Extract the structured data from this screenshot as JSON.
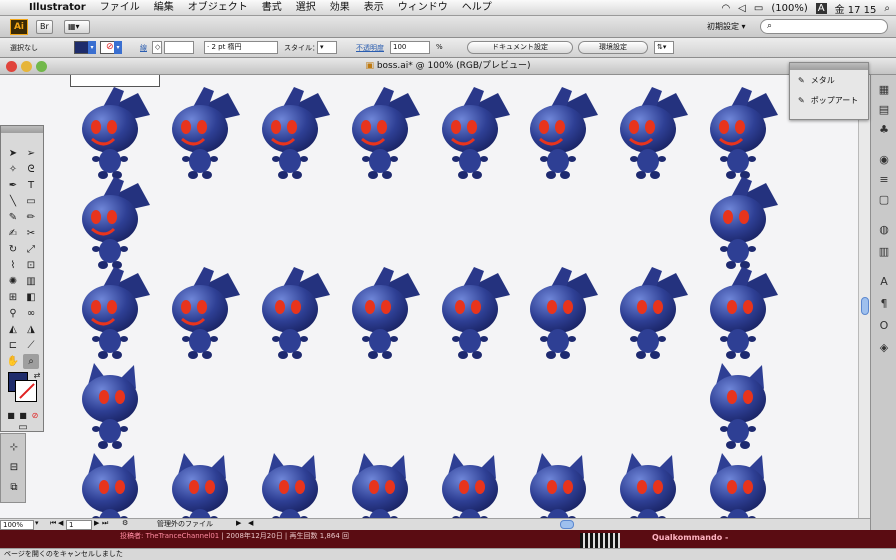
{
  "menubar": {
    "app_name": "Illustrator",
    "items": [
      "ファイル",
      "編集",
      "オブジェクト",
      "書式",
      "選択",
      "効果",
      "表示",
      "ウィンドウ",
      "ヘルプ"
    ],
    "battery": "(100%)",
    "input_indicator": "A",
    "clock": "金 17 15"
  },
  "appbar": {
    "logo": "Ai",
    "bridge_label": "Br",
    "workspace": "初期設定 ▾",
    "search_placeholder": ""
  },
  "control": {
    "selection": "選択なし",
    "stroke_link": "線",
    "stroke_weight": "",
    "brush_size": "2 pt 楕円",
    "style_label": "スタイル：",
    "opacity_link": "不透明度",
    "opacity_value": "100",
    "opacity_unit": "%",
    "doc_setup": "ドキュメント設定",
    "prefs": "環境設定",
    "fill_color": "#1e2c6b"
  },
  "document": {
    "title": "boss.ai* @ 100% (RGB/プレビュー)"
  },
  "statusbar": {
    "zoom": "100%",
    "artboard": "1",
    "status_menu": "管理外のファイル"
  },
  "web": {
    "meta_prefix": "投稿者:",
    "meta_user": "TheTranceChannel01",
    "meta_rest": "| 2008年12月20日 | 再生回数 1,864 回",
    "channel": "Qualkommando -",
    "browser_status": "ページを開くのをキャンセルしました"
  },
  "brush_panel": {
    "items": [
      {
        "label": "メタル",
        "icon": "metal-brush-icon"
      },
      {
        "label": "ポップアート",
        "icon": "popart-brush-icon"
      }
    ]
  },
  "colors": {
    "character_body": "#2e3f94",
    "character_eye": "#e8341c",
    "canvas": "#f4f4f6"
  },
  "characters": [
    {
      "row": 0,
      "col": 0,
      "pose": "front"
    },
    {
      "row": 0,
      "col": 1,
      "pose": "front"
    },
    {
      "row": 0,
      "col": 2,
      "pose": "front"
    },
    {
      "row": 0,
      "col": 3,
      "pose": "front"
    },
    {
      "row": 0,
      "col": 4,
      "pose": "front"
    },
    {
      "row": 0,
      "col": 5,
      "pose": "front"
    },
    {
      "row": 0,
      "col": 6,
      "pose": "front"
    },
    {
      "row": 0,
      "col": 7,
      "pose": "front"
    },
    {
      "row": 1,
      "col": 0,
      "pose": "front"
    },
    {
      "row": 1,
      "col": 7,
      "pose": "turn"
    },
    {
      "row": 2,
      "col": 0,
      "pose": "front"
    },
    {
      "row": 2,
      "col": 1,
      "pose": "front"
    },
    {
      "row": 2,
      "col": 2,
      "pose": "turn"
    },
    {
      "row": 2,
      "col": 3,
      "pose": "turn"
    },
    {
      "row": 2,
      "col": 4,
      "pose": "turn"
    },
    {
      "row": 2,
      "col": 5,
      "pose": "back"
    },
    {
      "row": 2,
      "col": 6,
      "pose": "back"
    },
    {
      "row": 2,
      "col": 7,
      "pose": "back"
    },
    {
      "row": 3,
      "col": 0,
      "pose": "cat"
    },
    {
      "row": 3,
      "col": 7,
      "pose": "cat"
    },
    {
      "row": 4,
      "col": 0,
      "pose": "cat"
    },
    {
      "row": 4,
      "col": 1,
      "pose": "cat"
    },
    {
      "row": 4,
      "col": 2,
      "pose": "cat"
    },
    {
      "row": 4,
      "col": 3,
      "pose": "cat"
    },
    {
      "row": 4,
      "col": 4,
      "pose": "cat"
    },
    {
      "row": 4,
      "col": 5,
      "pose": "cat"
    },
    {
      "row": 4,
      "col": 6,
      "pose": "cat"
    },
    {
      "row": 4,
      "col": 7,
      "pose": "cat"
    }
  ]
}
